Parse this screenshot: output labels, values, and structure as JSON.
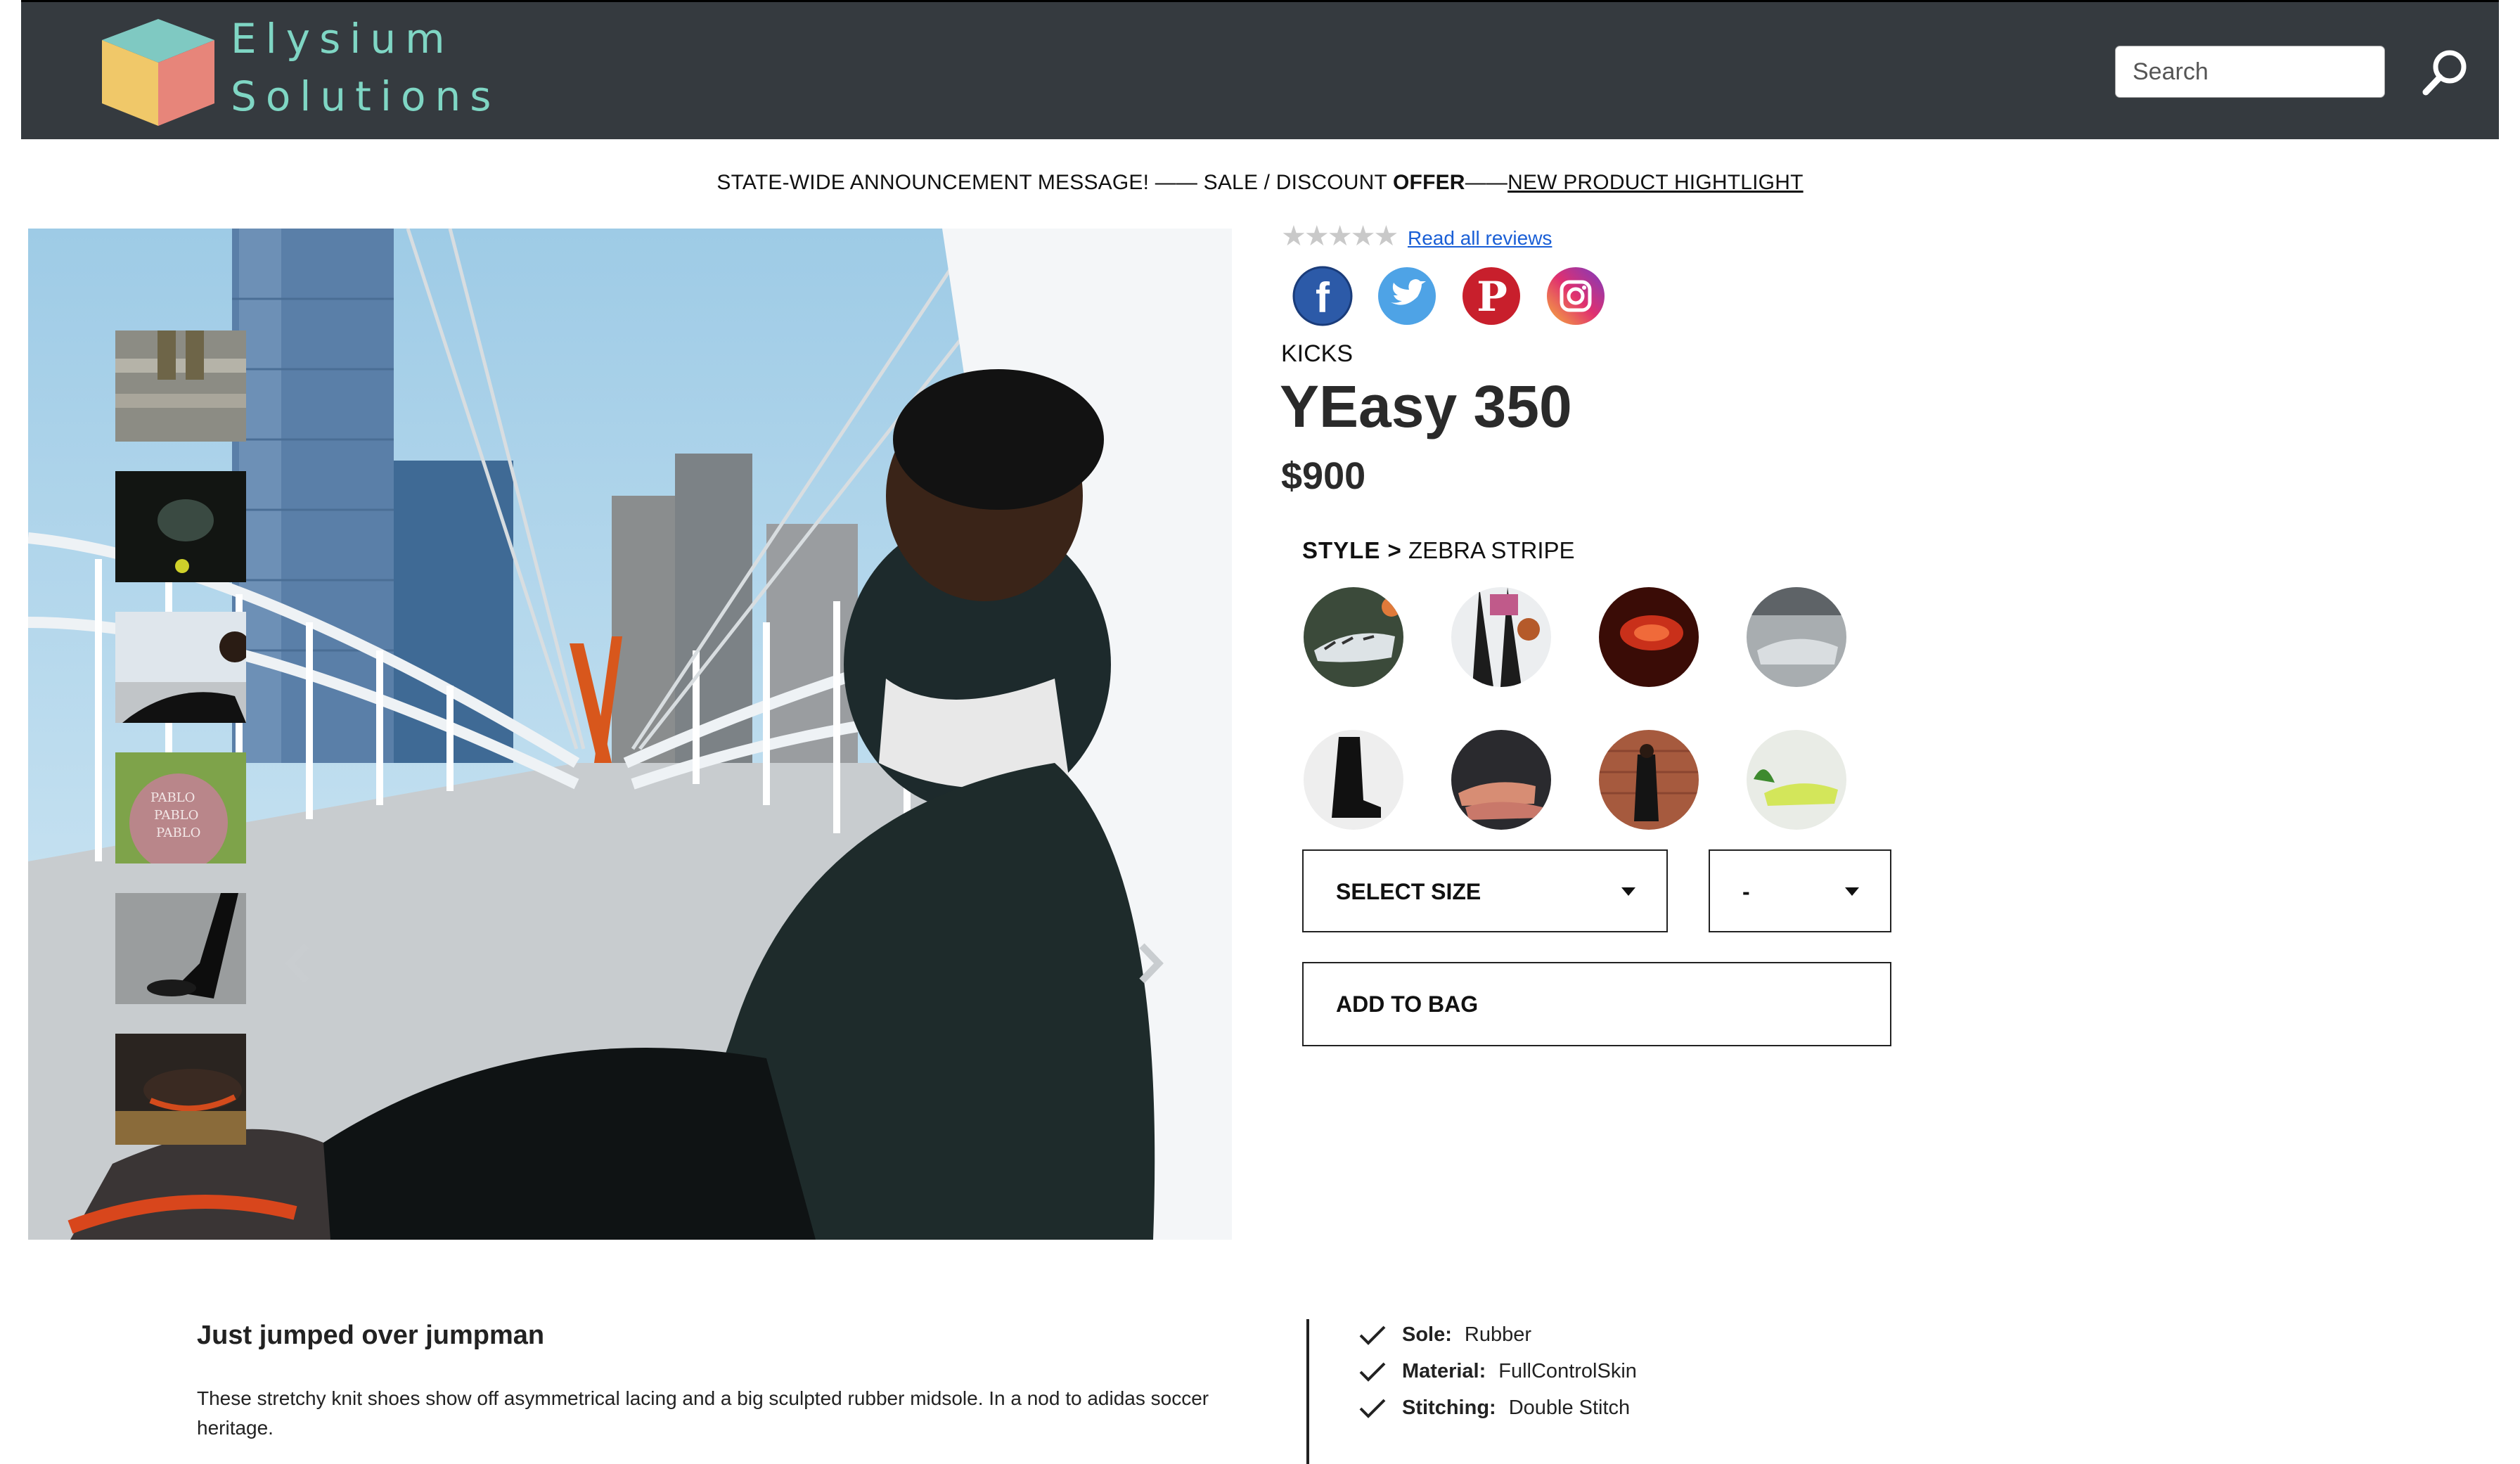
{
  "header": {
    "brand_line1": "Elysium",
    "brand_line2": "Solutions",
    "search_placeholder": "Search",
    "search_icon": "search-icon",
    "colors": {
      "bar": "#353a3f",
      "brand": "#7fd6c4"
    }
  },
  "announcement": {
    "part1": "STATE-WIDE ANNOUNCEMENT MESSAGE! —— SALE / DISCOUNT ",
    "offer": "OFFER",
    "dash": "——",
    "link": "NEW PRODUCT HIGHTLIGHT"
  },
  "gallery": {
    "thumbnails": [
      "stairs-shoes",
      "dark-street-crouch",
      "bridge-sitting",
      "pablo-hoodie",
      "walking-legs",
      "shoe-closeup"
    ],
    "prev_icon": "chevron-left-icon",
    "next_icon": "chevron-right-icon"
  },
  "product": {
    "rating_stars": "★★★★★",
    "rating_filled": 0,
    "reviews_link": "Read all reviews",
    "social": [
      "facebook-icon",
      "twitter-icon",
      "pinterest-icon",
      "instagram-icon"
    ],
    "category": "KICKS",
    "title": "YEasy 350",
    "price": "$900",
    "style_label": "STYLE >",
    "style_value": "ZEBRA STRIPE",
    "styles": [
      "zebra-stripe",
      "dribble",
      "red-glow",
      "grey-runner",
      "black-boot",
      "peach-pair",
      "brick-wall",
      "yellow-neon"
    ],
    "size_label": "SELECT SIZE",
    "qty_label": "-",
    "add_to_bag": "ADD TO BAG"
  },
  "description": {
    "title": "Just jumped over jumpman",
    "text": "These stretchy knit shoes show off asymmetrical lacing and a big sculpted rubber midsole. In a nod to adidas soccer heritage."
  },
  "specs": [
    {
      "key": "Sole:",
      "value": "Rubber"
    },
    {
      "key": "Material:",
      "value": "FullControlSkin"
    },
    {
      "key": "Stitching:",
      "value": "Double Stitch"
    }
  ]
}
